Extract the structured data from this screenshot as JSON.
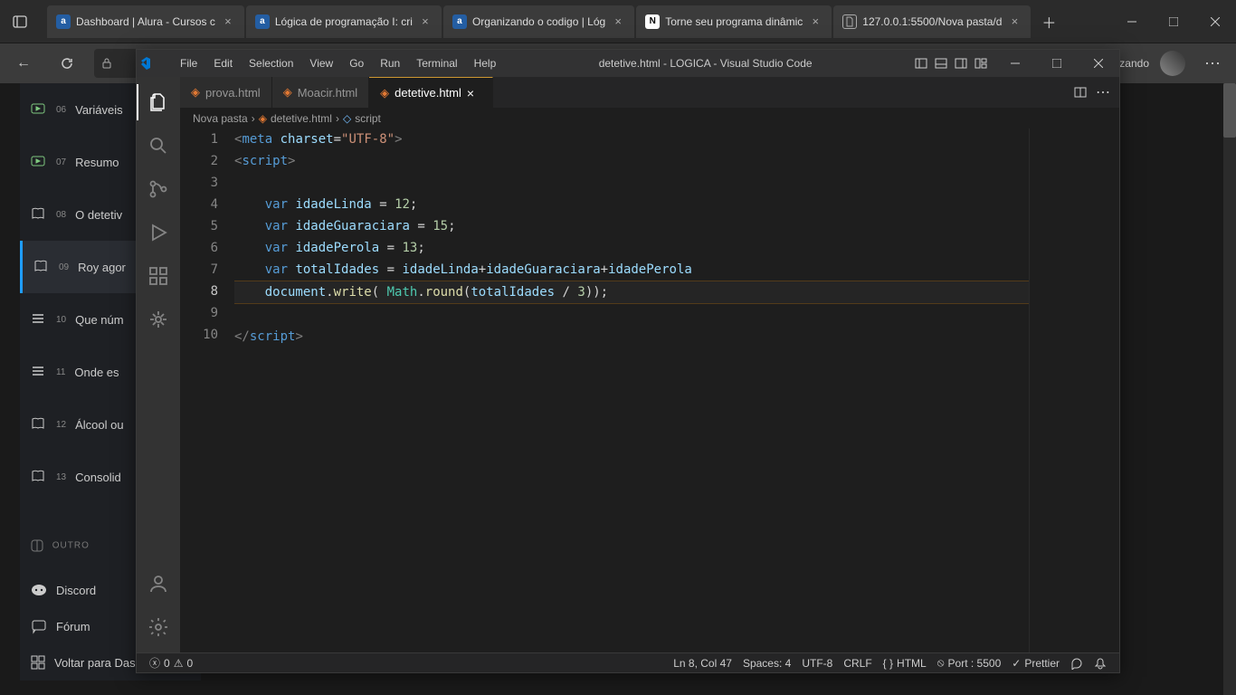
{
  "browser": {
    "tabs": [
      {
        "title": "Dashboard | Alura - Cursos c",
        "favicon": "a"
      },
      {
        "title": "Lógica de programação I: cri",
        "favicon": "a"
      },
      {
        "title": "Organizando o codigo | Lóg",
        "favicon": "a"
      },
      {
        "title": "Torne seu programa dinâmic",
        "favicon": "N"
      },
      {
        "title": "127.0.0.1:5500/Nova pasta/d",
        "favicon": "page"
      }
    ],
    "toolbar_right_text": "izando"
  },
  "alura": {
    "items": [
      {
        "num": "06",
        "label": "Variáveis"
      },
      {
        "num": "07",
        "label": "Resumo"
      },
      {
        "num": "08",
        "label": "O detetiv"
      },
      {
        "num": "09",
        "label": "Roy agor"
      },
      {
        "num": "10",
        "label": "Que núm"
      },
      {
        "num": "11",
        "label": "Onde es"
      },
      {
        "num": "12",
        "label": "Álcool ou"
      },
      {
        "num": "13",
        "label": "Consolid"
      }
    ],
    "divider": "OUTRO",
    "bottom": {
      "discord": "Discord",
      "forum": "Fórum",
      "back": "Voltar para Dashboard"
    }
  },
  "vscode": {
    "menu": [
      "File",
      "Edit",
      "Selection",
      "View",
      "Go",
      "Run",
      "Terminal",
      "Help"
    ],
    "title": "detetive.html - LOGICA - Visual Studio Code",
    "tabs": [
      {
        "label": "prova.html",
        "active": false
      },
      {
        "label": "Moacir.html",
        "active": false
      },
      {
        "label": "detetive.html",
        "active": true
      }
    ],
    "breadcrumb": {
      "folder": "Nova pasta",
      "file": "detetive.html",
      "symbol": "script"
    },
    "code": {
      "line1_tag": "meta",
      "line1_attr": "charset",
      "line1_val": "\"UTF-8\"",
      "line2_open": "script",
      "var_kw": "var",
      "v1_name": "idadeLinda",
      "v1_val": "12",
      "v2_name": "idadeGuaraciara",
      "v2_val": "15",
      "v3_name": "idadePerola",
      "v3_val": "13",
      "v4_name": "totalIdades",
      "doc_obj": "document",
      "write_fn": "write",
      "math_cls": "Math",
      "round_fn": "round",
      "divisor": "3",
      "line10_close": "script"
    },
    "status": {
      "errors": "0",
      "warnings": "0",
      "ln_col": "Ln 8, Col 47",
      "spaces": "Spaces: 4",
      "encoding": "UTF-8",
      "eol": "CRLF",
      "lang": "HTML",
      "port": "Port : 5500",
      "prettier": "Prettier"
    }
  }
}
